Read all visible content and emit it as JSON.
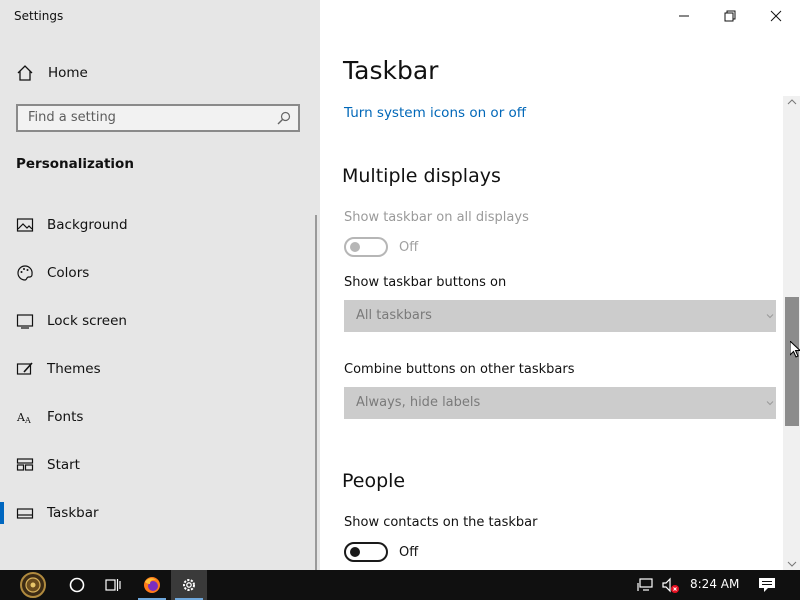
{
  "app": {
    "title": "Settings"
  },
  "sidebar": {
    "home_label": "Home",
    "search_placeholder": "Find a setting",
    "section_title": "Personalization",
    "items": [
      {
        "label": "Background",
        "icon": "image-icon"
      },
      {
        "label": "Colors",
        "icon": "palette-icon"
      },
      {
        "label": "Lock screen",
        "icon": "lock-screen-icon"
      },
      {
        "label": "Themes",
        "icon": "themes-icon"
      },
      {
        "label": "Fonts",
        "icon": "fonts-icon"
      },
      {
        "label": "Start",
        "icon": "start-icon"
      },
      {
        "label": "Taskbar",
        "icon": "taskbar-icon",
        "active": true
      }
    ]
  },
  "main": {
    "page_title": "Taskbar",
    "system_icons_link": "Turn system icons on or off",
    "multiple_displays": {
      "heading": "Multiple displays",
      "show_all_label": "Show taskbar on all displays",
      "show_all_state": "Off",
      "buttons_on_label": "Show taskbar buttons on",
      "buttons_on_value": "All taskbars",
      "combine_label": "Combine buttons on other taskbars",
      "combine_value": "Always, hide labels"
    },
    "people": {
      "heading": "People",
      "contacts_label": "Show contacts on the taskbar",
      "contacts_state": "Off"
    }
  },
  "taskbar": {
    "time": "8:24 AM",
    "apps": [
      "start-icon",
      "cortana-icon",
      "task-view-icon",
      "firefox-icon",
      "settings-icon"
    ],
    "tray": [
      "network-icon",
      "volume-muted-icon",
      "notification-icon"
    ]
  },
  "colors": {
    "accent": "#0067c0",
    "link": "#0067b8",
    "sidebar_bg": "#e6e6e6",
    "taskbar_bg": "#101010"
  }
}
